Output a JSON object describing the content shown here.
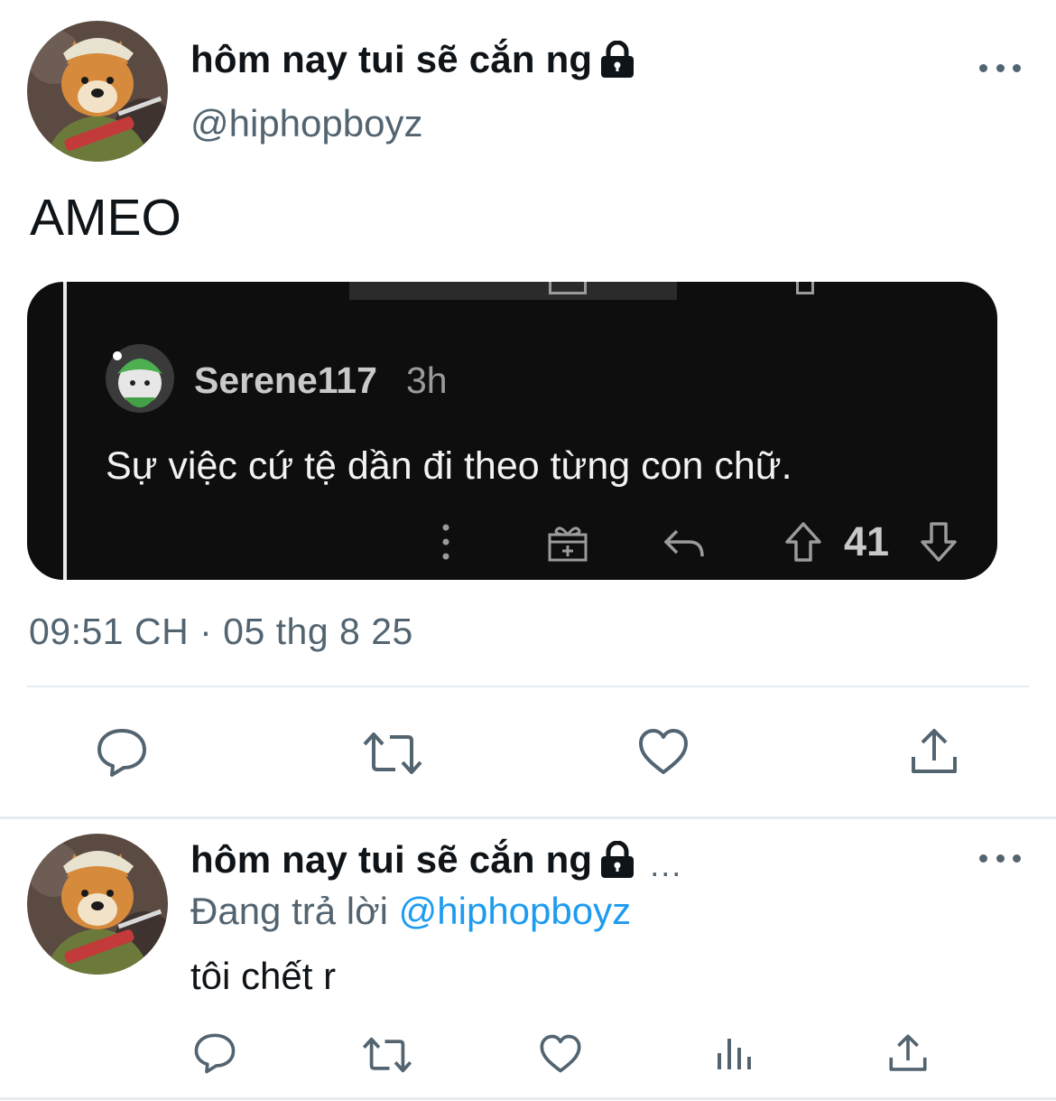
{
  "tweet": {
    "display_name": "hôm nay tui sẽ cắn ng",
    "handle": "@hiphopboyz",
    "text": "AMEO",
    "timestamp": "09:51 CH · 05 thg 8 25",
    "avatar_icon": "shiba-dog-avatar",
    "lock_icon": "lock-icon",
    "media": {
      "username": "Serene117",
      "time": "3h",
      "comment": "Sự việc cứ tệ dần đi theo từng con chữ.",
      "vote_count": "41"
    }
  },
  "reply": {
    "display_name": "hôm nay tui sẽ cắn ng",
    "truncation": "...",
    "replying_label": "Đang trả lời",
    "replying_to": "@hiphopboyz",
    "text": "tôi chết r"
  },
  "colors": {
    "text": "#0f1419",
    "secondary": "#536471",
    "link": "#1d9bf0",
    "divider": "#e6ecf0",
    "media_bg": "#0e0e0e"
  }
}
